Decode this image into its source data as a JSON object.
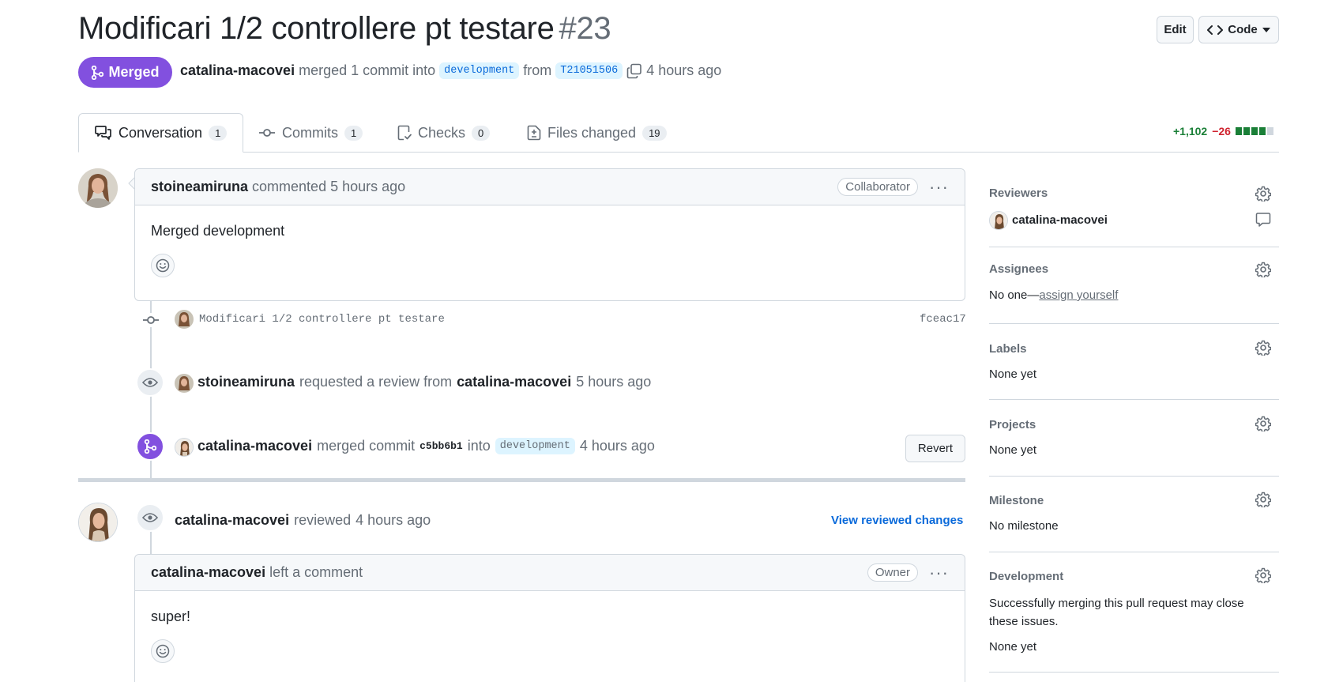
{
  "header": {
    "title": "Modificari 1/2 controllere pt testare",
    "number": "#23",
    "edit_label": "Edit",
    "code_label": "Code"
  },
  "status": {
    "state": "Merged",
    "author": "catalina-macovei",
    "action": "merged 1 commit into",
    "base_branch": "development",
    "from_word": "from",
    "head_branch": "T21051506",
    "time": "4 hours ago"
  },
  "tabs": [
    {
      "label": "Conversation",
      "count": "1",
      "icon": "comment-discussion-icon"
    },
    {
      "label": "Commits",
      "count": "1",
      "icon": "commit-icon"
    },
    {
      "label": "Checks",
      "count": "0",
      "icon": "checklist-icon"
    },
    {
      "label": "Files changed",
      "count": "19",
      "icon": "file-diff-icon"
    }
  ],
  "diffstat": {
    "additions": "+1,102",
    "deletions": "−26",
    "add_blocks": 4,
    "del_blocks": 1
  },
  "timeline": {
    "comment1": {
      "author": "stoineamiruna",
      "action": "commented",
      "time": "5 hours ago",
      "role": "Collaborator",
      "body": "Merged development"
    },
    "commit": {
      "message": "Modificari 1/2 controllere pt testare",
      "sha": "fceac17"
    },
    "review_request": {
      "actor": "stoineamiruna",
      "action": "requested a review from",
      "target": "catalina-macovei",
      "time": "5 hours ago"
    },
    "merge_event": {
      "actor": "catalina-macovei",
      "action": "merged commit",
      "sha": "c5bb6b1",
      "into_word": "into",
      "branch": "development",
      "time": "4 hours ago",
      "revert_label": "Revert"
    },
    "review": {
      "actor": "catalina-macovei",
      "action": "reviewed",
      "time": "4 hours ago",
      "link": "View reviewed changes"
    },
    "comment2": {
      "author": "catalina-macovei",
      "action": "left a comment",
      "role": "Owner",
      "body": "super!"
    }
  },
  "sidebar": {
    "reviewers": {
      "title": "Reviewers",
      "name": "catalina-macovei"
    },
    "assignees": {
      "title": "Assignees",
      "value_prefix": "No one—",
      "link": "assign yourself"
    },
    "labels": {
      "title": "Labels",
      "value": "None yet"
    },
    "projects": {
      "title": "Projects",
      "value": "None yet"
    },
    "milestone": {
      "title": "Milestone",
      "value": "No milestone"
    },
    "development": {
      "title": "Development",
      "description": "Successfully merging this pull request may close these issues.",
      "value": "None yet"
    }
  },
  "colors": {
    "merged": "#8250df",
    "addition": "#1a7f37",
    "deletion": "#cf222e",
    "link": "#0969da"
  }
}
